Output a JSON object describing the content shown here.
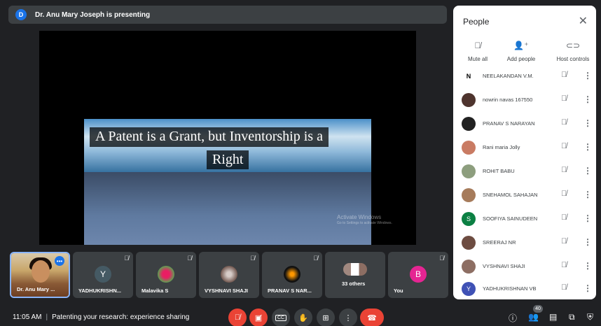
{
  "presenting": {
    "avatar_letter": "D",
    "text": "Dr. Anu Mary Joseph is presenting"
  },
  "slide": {
    "line1": "A Patent is a Grant, but Inventorship is a",
    "line2": "Right",
    "watermark_title": "Activate Windows",
    "watermark_sub": "Go to Settings to activate Windows."
  },
  "tiles": [
    {
      "name": "Dr. Anu Mary ...",
      "avatar": ""
    },
    {
      "name": "YADHUKRISHN...",
      "avatar": "Y"
    },
    {
      "name": "Malavika S",
      "avatar": ""
    },
    {
      "name": "VYSHNAVI SHAJI",
      "avatar": ""
    },
    {
      "name": "PRANAV S NAR...",
      "avatar": ""
    },
    {
      "name": "33 others",
      "avatar": ""
    },
    {
      "name": "You",
      "avatar": "B"
    }
  ],
  "bottom": {
    "time": "11:05 AM",
    "separator": "|",
    "meeting_title": "Patenting your research: experience sharing",
    "participant_count": "40"
  },
  "panel": {
    "title": "People",
    "actions": [
      {
        "label": "Mute all",
        "icon": "mic-off-icon"
      },
      {
        "label": "Add people",
        "icon": "person-add-icon"
      },
      {
        "label": "Host controls",
        "icon": "toggle-icon"
      }
    ],
    "people": [
      {
        "name": "NEELAKANDAN V.M.",
        "avatar": "N",
        "color": "#ffffff"
      },
      {
        "name": "nowrin navas 167550",
        "avatar": "",
        "color": "#4e342e"
      },
      {
        "name": "PRANAV S NARAYAN",
        "avatar": "",
        "color": "#212121"
      },
      {
        "name": "Rani maria Jolly",
        "avatar": "",
        "color": "#c97b63"
      },
      {
        "name": "ROHIT BABU",
        "avatar": "",
        "color": "#8d9e7e"
      },
      {
        "name": "SNEHAMOL SAHAJAN",
        "avatar": "",
        "color": "#a67b5b"
      },
      {
        "name": "SOOFIYA SAINUDEEN",
        "avatar": "S",
        "color": "#0b8043"
      },
      {
        "name": "SREERAJ NR",
        "avatar": "",
        "color": "#6d4c41"
      },
      {
        "name": "VYSHNAVI SHAJI",
        "avatar": "",
        "color": "#8d6e63"
      },
      {
        "name": "YADHUKRISHNAN VB",
        "avatar": "Y",
        "color": "#3f51b5"
      }
    ]
  }
}
